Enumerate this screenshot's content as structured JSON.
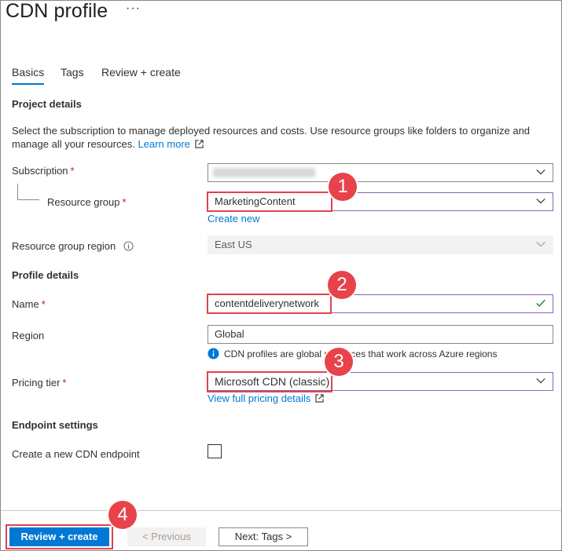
{
  "header": {
    "title": "CDN profile",
    "more": "···"
  },
  "tabs": [
    {
      "label": "Basics"
    },
    {
      "label": "Tags"
    },
    {
      "label": "Review + create"
    }
  ],
  "project": {
    "heading": "Project details",
    "description": "Select the subscription to manage deployed resources and costs. Use resource groups like folders to organize and manage all your resources.",
    "learn_more": "Learn more",
    "subscription_label": "Subscription",
    "resource_group_label": "Resource group",
    "resource_group_value": "MarketingContent",
    "create_new": "Create new",
    "region_label": "Resource group region",
    "region_value": "East US"
  },
  "profile": {
    "heading": "Profile details",
    "name_label": "Name",
    "name_value": "contentdeliverynetwork",
    "region_label": "Region",
    "region_value": "Global",
    "region_info": "CDN profiles are global resources that work across Azure regions",
    "pricing_label": "Pricing tier",
    "pricing_value": "Microsoft CDN (classic)",
    "pricing_link": "View full pricing details"
  },
  "endpoint": {
    "heading": "Endpoint settings",
    "create_label": "Create a new CDN endpoint",
    "create_checked": false
  },
  "footer": {
    "review_create": "Review + create",
    "previous": "< Previous",
    "next": "Next: Tags >"
  },
  "required_mark": "*",
  "callouts": [
    "1",
    "2",
    "3",
    "4"
  ],
  "colors": {
    "accent": "#0078d4",
    "highlight": "#e2424b",
    "required": "#a4262c",
    "valid": "#107c10"
  }
}
